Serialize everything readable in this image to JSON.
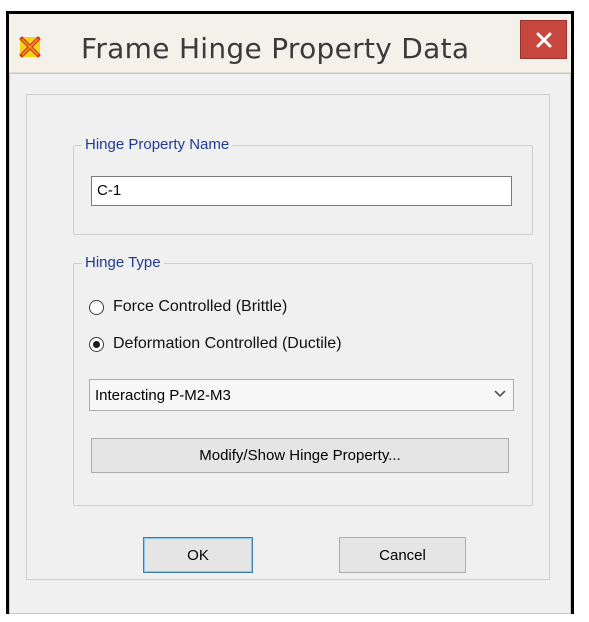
{
  "window": {
    "title": "Frame Hinge Property Data",
    "icons": {
      "app": "sap-x-logo-icon",
      "close": "close-icon"
    },
    "colors": {
      "close_button": "#c7463d",
      "group_label": "#1f3a93"
    }
  },
  "hinge_property_name": {
    "label": "Hinge Property Name",
    "value": "C-1"
  },
  "hinge_type": {
    "label": "Hinge Type",
    "options": [
      {
        "label": "Force Controlled  (Brittle)",
        "selected": false
      },
      {
        "label": "Deformation Controlled  (Ductile)",
        "selected": true
      }
    ],
    "dropdown_value": "Interacting P-M2-M3",
    "modify_button": "Modify/Show Hinge Property..."
  },
  "footer": {
    "ok": "OK",
    "cancel": "Cancel"
  }
}
